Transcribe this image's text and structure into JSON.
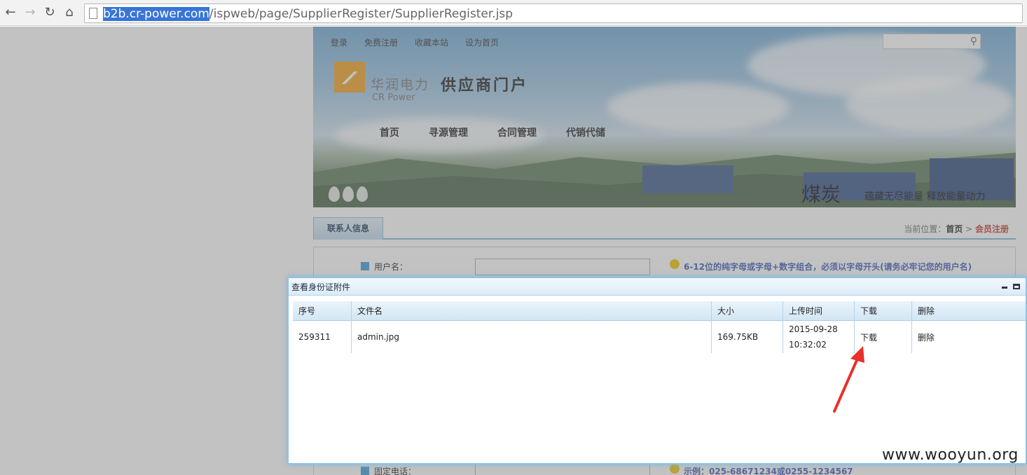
{
  "browser": {
    "url_host": "b2b.cr-power.com",
    "url_path": "/ispweb/page/SupplierRegister/SupplierRegister.jsp"
  },
  "site": {
    "top_links": [
      "登录",
      "免费注册",
      "收藏本站",
      "设为首页"
    ],
    "logo_cn": "华润电力",
    "logo_en": "CR Power",
    "portal_title": "供应商门户",
    "main_nav": [
      "首页",
      "寻源管理",
      "合同管理",
      "代销代储"
    ],
    "banner_big": "煤炭",
    "banner_slogan": "蕴藏无尽能量  释放能量动力",
    "tab_label": "联系人信息",
    "breadcrumb_prefix": "当前位置：",
    "breadcrumb_home": "首页",
    "breadcrumb_sep": ">",
    "breadcrumb_current": "会员注册"
  },
  "form": {
    "username_label": "用户名：",
    "username_hint": "6-12位的纯字母或字母+数字组合，必须以字母开头(请务必牢记您的用户名)",
    "phone_label": "固定电话：",
    "phone_hint": "示例：025-68671234或0255-1234567"
  },
  "modal": {
    "title": "查看身份证附件",
    "columns": [
      "序号",
      "文件名",
      "大小",
      "上传时间",
      "下载",
      "删除"
    ],
    "rows": [
      {
        "id": "259311",
        "filename": "admin.jpg",
        "size": "169.75KB",
        "upload_date": "2015-09-28",
        "upload_time": "10:32:02",
        "download": "下载",
        "delete": "删除"
      }
    ]
  },
  "watermark": "www.wooyun.org",
  "colors": {
    "accent": "#3d9bd6",
    "highlight": "#3875d7",
    "arrow": "#e8302a",
    "hint": "#3a56b8"
  }
}
